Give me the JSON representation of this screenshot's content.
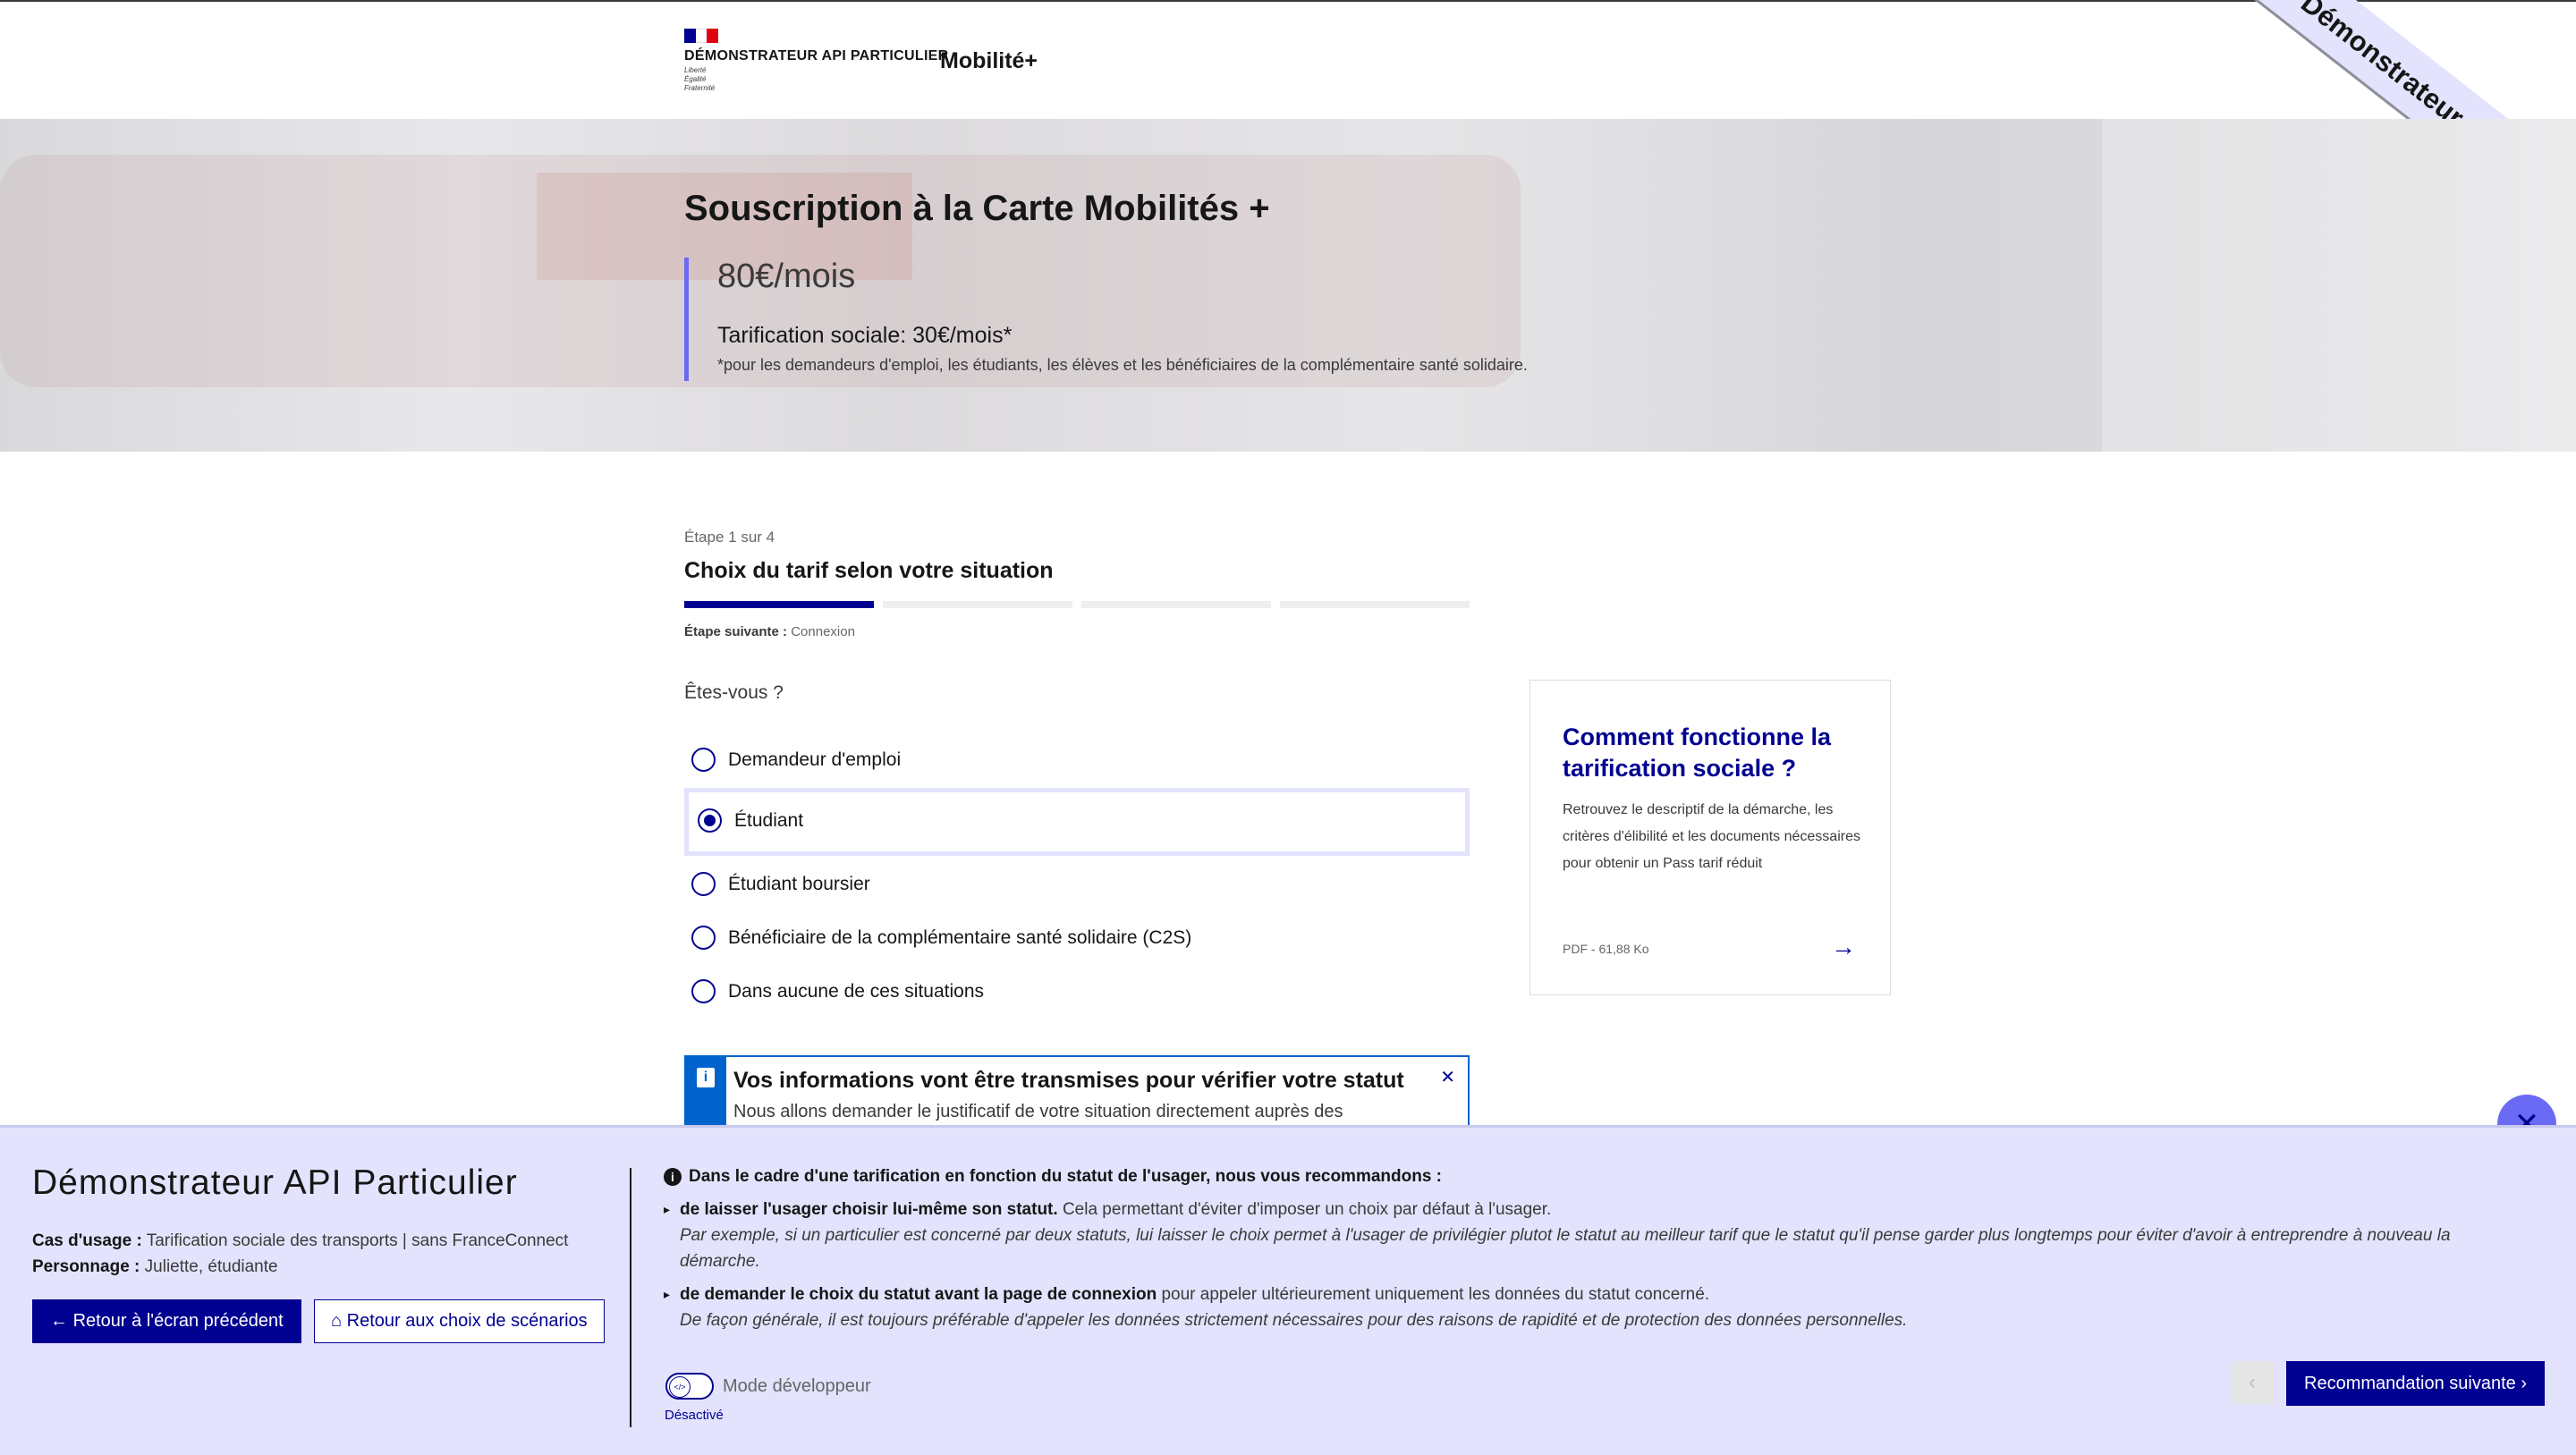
{
  "header": {
    "logo_title": "DÉMONSTRATEUR API PARTICULIER",
    "motto": [
      "Liberté",
      "Égalité",
      "Fraternité"
    ],
    "service_name": "Mobilité+",
    "ribbon": "Démonstrateur API Particulier"
  },
  "hero": {
    "title": "Souscription à la Carte Mobilités +",
    "price": "80€/mois",
    "social": "Tarification sociale: 30€/mois*",
    "note": "*pour les demandeurs d'emploi, les étudiants, les élèves et les bénéficiaires de la complémentaire santé solidaire."
  },
  "stepper": {
    "count": "Étape 1 sur 4",
    "title": "Choix du tarif selon votre situation",
    "next_label": "Étape suivante :",
    "next_value": "Connexion",
    "current": 1,
    "total": 4
  },
  "form": {
    "question": "Êtes-vous ?",
    "options": [
      {
        "label": "Demandeur d'emploi",
        "checked": false
      },
      {
        "label": "Étudiant",
        "checked": true
      },
      {
        "label": "Étudiant boursier",
        "checked": false
      },
      {
        "label": "Bénéficiaire de la complémentaire santé solidaire (C2S)",
        "checked": false
      },
      {
        "label": "Dans aucune de ces situations",
        "checked": false
      }
    ]
  },
  "alert": {
    "title": "Vos informations vont être transmises pour vérifier votre statut",
    "body": "Nous allons demander le justificatif de votre situation directement auprès des"
  },
  "card": {
    "title": "Comment fonctionne la tarification sociale ?",
    "description": "Retrouvez le descriptif de la démarche, les critères d'élibilité et les documents nécessaires pour obtenir un Pass tarif réduit",
    "meta": "PDF - 61,88 Ko"
  },
  "panel": {
    "title": "Démonstrateur API Particulier",
    "use_case_label": "Cas d'usage :",
    "use_case_value": "Tarification sociale des transports | sans FranceConnect",
    "persona_label": "Personnage :",
    "persona_value": "Juliette, étudiante",
    "back_button": "Retour à l'écran précédent",
    "scenarios_button": "Retour aux choix de scénarios",
    "rec_head": "Dans le cadre d'une tarification en fonction du statut de l'usager, nous vous recommandons :",
    "rec1_bold": "de laisser l'usager choisir lui-même son statut.",
    "rec1_text": "Cela permettant d'éviter d'imposer un choix par défaut à l'usager.",
    "rec1_italic": "Par exemple, si un particulier est concerné par deux statuts, lui laisser le choix permet à l'usager de privilégier plutot le statut au meilleur tarif que le statut qu'il pense garder plus longtemps pour éviter d'avoir à entreprendre à nouveau la démarche.",
    "rec2_bold": "de demander le choix du statut avant la page de connexion",
    "rec2_text": "pour appeler ultérieurement uniquement les données du statut concerné.",
    "rec2_italic": "De façon générale, il est toujours préférable d'appeler les données strictement nécessaires pour des raisons de rapidité et de protection des données personnelles.",
    "dev_mode_label": "Mode développeur",
    "dev_mode_state": "Désactivé",
    "next_rec_button": "Recommandation suivante"
  },
  "colors": {
    "primary": "#000091",
    "accent": "#6a6af4",
    "panel_bg": "#e3e3fd",
    "info": "#0063cb"
  },
  "icons": [
    "close-icon",
    "arrow-left-icon",
    "home-icon",
    "info-icon",
    "arrow-right-icon",
    "chevron-left-icon",
    "chevron-right-icon",
    "code-icon"
  ]
}
